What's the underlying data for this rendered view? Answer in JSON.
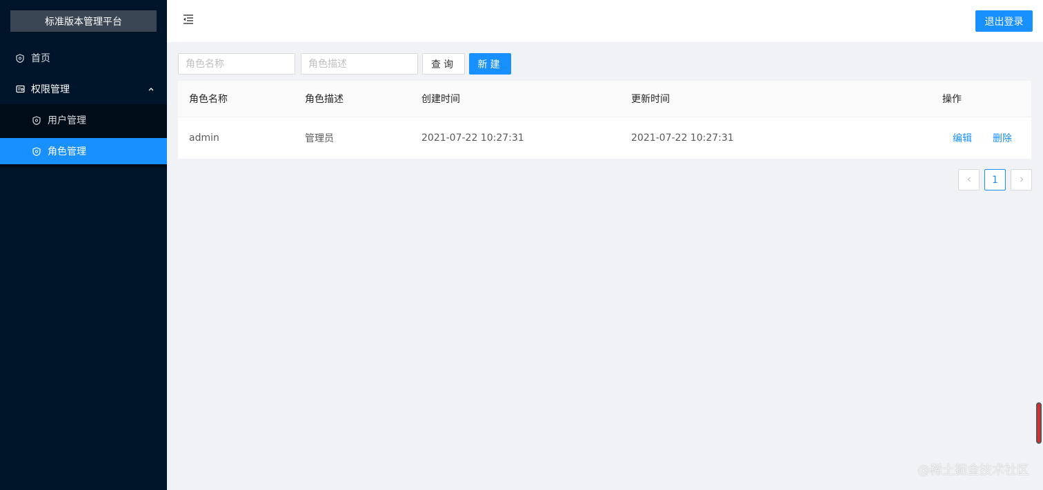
{
  "sidebar": {
    "logo": "标准版本管理平台",
    "items": [
      {
        "label": "首页"
      },
      {
        "label": "权限管理"
      },
      {
        "label": "用户管理"
      },
      {
        "label": "角色管理"
      }
    ]
  },
  "header": {
    "logout_label": "退出登录"
  },
  "search": {
    "role_name_placeholder": "角色名称",
    "role_desc_placeholder": "角色描述",
    "query_label": "查询",
    "new_label": "新建"
  },
  "table": {
    "columns": [
      "角色名称",
      "角色描述",
      "创建时间",
      "更新时间",
      "操作"
    ],
    "rows": [
      {
        "name": "admin",
        "desc": "管理员",
        "created": "2021-07-22 10:27:31",
        "updated": "2021-07-22 10:27:31",
        "edit": "编辑",
        "delete": "删除"
      }
    ]
  },
  "pagination": {
    "current": "1"
  },
  "colors": {
    "accent": "#1890ff",
    "sidebar_bg": "#001529"
  },
  "watermark": "@稀土掘金技术社区"
}
